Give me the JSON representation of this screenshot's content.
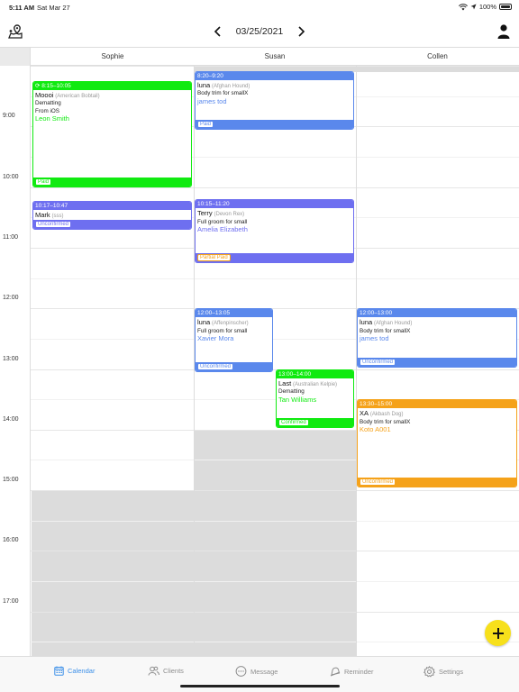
{
  "status_bar": {
    "time": "5:11 AM",
    "date": "Sat Mar 27",
    "battery": "100%"
  },
  "header": {
    "date": "03/25/2021"
  },
  "staff": [
    {
      "name": "Sophie"
    },
    {
      "name": "Susan"
    },
    {
      "name": "Collen"
    }
  ],
  "hours": [
    "9:00",
    "10:00",
    "11:00",
    "12:00",
    "13:00",
    "14:00",
    "15:00",
    "16:00",
    "17:00"
  ],
  "colors": {
    "green": "#10ea10",
    "blue": "#5a88ec",
    "purple": "#6e6ff0",
    "orange": "#f5a21a",
    "accent": "#3b8fe8",
    "fab": "#f7e01b"
  },
  "appointments": [
    {
      "staff": "Sophie",
      "time": "8:15–10:05",
      "pet": "Moooi",
      "breed": "(American Bobtail)",
      "service": "Dematting",
      "note": "From iOS",
      "client": "Leon Smith",
      "status": "Paid",
      "color": "green",
      "start": 8.25,
      "end": 10.0,
      "half": "full",
      "recurring": true
    },
    {
      "staff": "Susan",
      "time": "8:20–9:20",
      "pet": "luna",
      "breed": "(Afghan Hound)",
      "service": "Body trim for smallX",
      "client": "james tod",
      "status": "Paid",
      "color": "blue",
      "start": 8.0833,
      "end": 9.05,
      "half": "full"
    },
    {
      "staff": "Sophie",
      "time": "10:17–10:47",
      "pet": "Mark",
      "breed": "(sss)",
      "service": "",
      "client": "",
      "status": "Unconfirmed",
      "color": "purple",
      "start": 10.2333,
      "end": 10.7,
      "half": "full"
    },
    {
      "staff": "Susan",
      "time": "10:15–11:20",
      "pet": "Terry",
      "breed": "(Devon Rex)",
      "service": "Full groom for small",
      "client": "Amelia Elizabeth",
      "status": "Partial Paid",
      "status_color": "#f5a21a",
      "color": "purple",
      "start": 10.2,
      "end": 11.25,
      "half": "full"
    },
    {
      "staff": "Susan",
      "time": "12:00–13:05",
      "pet": "luna",
      "breed": "(Affenpinscher)",
      "service": "Full groom for small",
      "client": "Xavier Mora",
      "status": "Unconfirmed",
      "color": "blue",
      "start": 12.0,
      "end": 13.05,
      "half": "left"
    },
    {
      "staff": "Susan",
      "time": "13:00–14:00",
      "pet": "Last",
      "breed": "(Australian Kelpie)",
      "service": "Dematting",
      "client": "Tan Williams",
      "status": "Confirmed",
      "color": "green",
      "start": 13.0,
      "end": 13.98,
      "half": "right"
    },
    {
      "staff": "Collen",
      "time": "12:00–13:00",
      "pet": "luna",
      "breed": "(Afghan Hound)",
      "service": "Body trim for smallX",
      "client": "james tod",
      "status": "Unconfirmed",
      "color": "blue",
      "start": 12.0,
      "end": 12.98,
      "half": "full"
    },
    {
      "staff": "Collen",
      "time": "13:30–15:00",
      "pet": "XA",
      "breed": "(Akbash Dog)",
      "service": "Body trim for smallX",
      "client": "Koto A001",
      "status": "Unconfirmed",
      "color": "orange",
      "start": 13.5,
      "end": 14.95,
      "half": "full"
    }
  ],
  "unavailable": [
    {
      "staff": "Sophie",
      "from": 15.0,
      "to": 18.5
    },
    {
      "staff": "Susan",
      "from": 14.0,
      "to": 18.5
    },
    {
      "staff": "Susan",
      "from": 8.0,
      "to": 8.1
    },
    {
      "staff": "Collen",
      "from": 8.0,
      "to": 8.1
    }
  ],
  "tabs": [
    {
      "label": "Calendar",
      "icon": "calendar-icon",
      "active": true
    },
    {
      "label": "Clients",
      "icon": "clients-icon",
      "active": false
    },
    {
      "label": "Message",
      "icon": "message-icon",
      "active": false
    },
    {
      "label": "Reminder",
      "icon": "reminder-icon",
      "active": false
    },
    {
      "label": "Settings",
      "icon": "settings-icon",
      "active": false
    }
  ]
}
